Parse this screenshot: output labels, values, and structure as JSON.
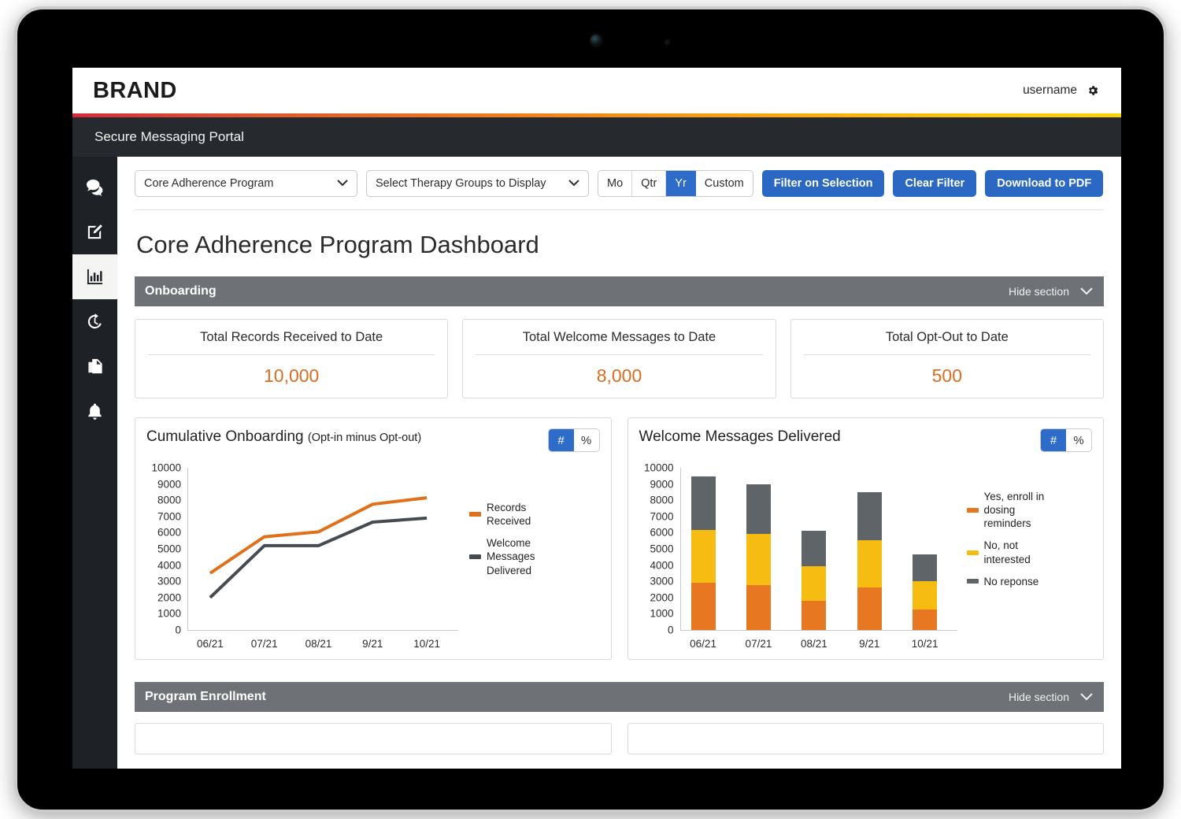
{
  "brand": {
    "logo": "BRAND",
    "username": "username",
    "gear_icon": "gear-icon"
  },
  "portal": {
    "title": "Secure Messaging Portal"
  },
  "sidebar": {
    "items": [
      {
        "name": "messages",
        "icon": "chat-bubbles-icon",
        "active": false
      },
      {
        "name": "compose",
        "icon": "compose-edit-icon",
        "active": false
      },
      {
        "name": "reports",
        "icon": "bar-chart-icon",
        "active": true
      },
      {
        "name": "history",
        "icon": "history-clock-icon",
        "active": false
      },
      {
        "name": "documents",
        "icon": "copy-documents-icon",
        "active": false
      },
      {
        "name": "alerts",
        "icon": "bell-icon",
        "active": false
      }
    ]
  },
  "filters": {
    "program_select": {
      "value": "Core Adherence Program",
      "icon": "chevron-down-icon"
    },
    "therapy_select": {
      "value": "Select Therapy Groups to Display",
      "icon": "chevron-down-icon"
    },
    "period": {
      "options": [
        "Mo",
        "Qtr",
        "Yr",
        "Custom"
      ],
      "selected": "Yr"
    },
    "buttons": {
      "filter": "Filter on Selection",
      "clear": "Clear Filter",
      "download": "Download to PDF"
    }
  },
  "page": {
    "title": "Core Adherence Program Dashboard"
  },
  "sections": {
    "onboarding": {
      "title": "Onboarding",
      "hide_label": "Hide section",
      "chevron": "chevron-down-icon"
    },
    "enrollment": {
      "title": "Program Enrollment",
      "hide_label": "Hide section",
      "chevron": "chevron-down-icon"
    }
  },
  "stats": [
    {
      "label": "Total Records Received to Date",
      "value": "10,000"
    },
    {
      "label": "Total Welcome Messages to Date",
      "value": "8,000"
    },
    {
      "label": "Total Opt-Out to Date",
      "value": "500"
    }
  ],
  "colors": {
    "accent_blue": "#2b68c4",
    "orange_line": "#e0701a",
    "orange_bar": "#e87722",
    "yellow_bar": "#f7bc11",
    "gray_bar": "#5f6468",
    "stat_value": "#dd6b20",
    "section_header": "#6e7276"
  },
  "chart_data": [
    {
      "type": "line",
      "title": "Cumulative Onboarding",
      "subtitle": "(Opt-in minus Opt-out)",
      "toggle": {
        "options": [
          "#",
          "%"
        ],
        "selected": "#"
      },
      "categories": [
        "06/21",
        "07/21",
        "08/21",
        "9/21",
        "10/21"
      ],
      "ylim": [
        0,
        10000
      ],
      "yticks": [
        0,
        1000,
        2000,
        3000,
        4000,
        5000,
        6000,
        7000,
        8000,
        9000,
        10000
      ],
      "xlabel": "",
      "ylabel": "",
      "grid": false,
      "legend_position": "right",
      "series": [
        {
          "name": "Records Received",
          "color": "#e0701a",
          "values": [
            3500,
            5750,
            6050,
            7750,
            8150
          ]
        },
        {
          "name": "Welcome Messages Delivered",
          "color": "#464b50",
          "values": [
            2000,
            5200,
            5200,
            6650,
            6900
          ]
        }
      ]
    },
    {
      "type": "bar",
      "title": "Welcome Messages Delivered",
      "toggle": {
        "options": [
          "#",
          "%"
        ],
        "selected": "#"
      },
      "categories": [
        "06/21",
        "07/21",
        "08/21",
        "9/21",
        "10/21"
      ],
      "ylim": [
        0,
        10000
      ],
      "yticks": [
        0,
        1000,
        2000,
        3000,
        4000,
        5000,
        6000,
        7000,
        8000,
        9000,
        10000
      ],
      "stacked": true,
      "grid": false,
      "legend_position": "right",
      "series": [
        {
          "name": "Yes, enroll in dosing reminders",
          "color": "#e87722",
          "values": [
            2900,
            2750,
            1800,
            2600,
            1250
          ]
        },
        {
          "name": "No, not interested",
          "color": "#f7bc11",
          "values": [
            3250,
            3150,
            2150,
            2950,
            1750
          ]
        },
        {
          "name": "No reponse",
          "color": "#5f6468",
          "values": [
            3300,
            3100,
            2150,
            2950,
            1650
          ]
        }
      ]
    }
  ]
}
